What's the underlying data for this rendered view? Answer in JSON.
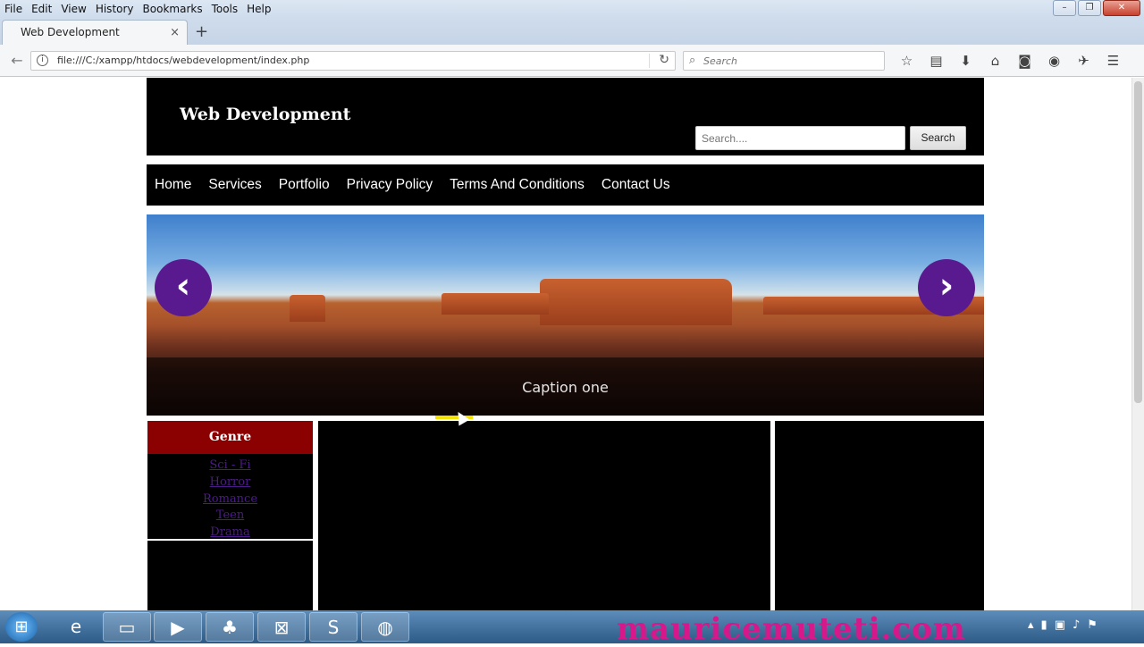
{
  "browser": {
    "menu": [
      "File",
      "Edit",
      "View",
      "History",
      "Bookmarks",
      "Tools",
      "Help"
    ],
    "tab_title": "Web Development",
    "tab_close": "×",
    "new_tab": "+",
    "url": "file:///C:/xampp/htdocs/webdevelopment/index.php",
    "search_placeholder": "Search",
    "window_controls": [
      "–",
      "❐",
      "✕"
    ]
  },
  "site": {
    "title": "Web Development",
    "search_placeholder": "Search....",
    "search_button": "Search",
    "nav": [
      "Home",
      "Services",
      "Portfolio",
      "Privacy Policy",
      "Terms And Conditions",
      "Contact Us"
    ],
    "slider": {
      "caption": "Caption one",
      "prev": "‹",
      "next": "›"
    },
    "sidebar": {
      "heading": "Genre",
      "genres": [
        "Sci - Fi",
        "Horror",
        "Romance",
        "Teen",
        "Drama"
      ]
    }
  },
  "taskbar": {
    "watermark": "mauricemuteti.com",
    "apps": [
      "internet-explorer",
      "file-explorer",
      "media-player",
      "games",
      "xampp",
      "sublime-text",
      "firefox"
    ]
  },
  "colors": {
    "header_bg": "#000000",
    "genre_heading_bg": "#8b0000",
    "slider_arrow": "#5a1a8f",
    "genre_link": "#4b1d84",
    "watermark": "#d6188a"
  }
}
